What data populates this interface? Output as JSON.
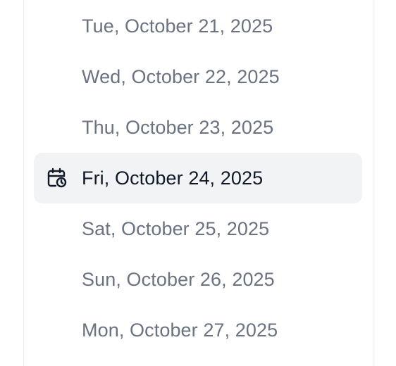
{
  "date_list": {
    "items": [
      {
        "label": "Tue, October 21, 2025",
        "selected": false
      },
      {
        "label": "Wed, October 22, 2025",
        "selected": false
      },
      {
        "label": "Thu, October 23, 2025",
        "selected": false
      },
      {
        "label": "Fri, October 24, 2025",
        "selected": true,
        "icon": "calendar-clock-icon"
      },
      {
        "label": "Sat, October 25, 2025",
        "selected": false
      },
      {
        "label": "Sun, October 26, 2025",
        "selected": false
      },
      {
        "label": "Mon, October 27, 2025",
        "selected": false
      }
    ]
  },
  "colors": {
    "selected_background": "#f2f3f5",
    "selected_text": "#111827",
    "text": "#6b7280"
  }
}
